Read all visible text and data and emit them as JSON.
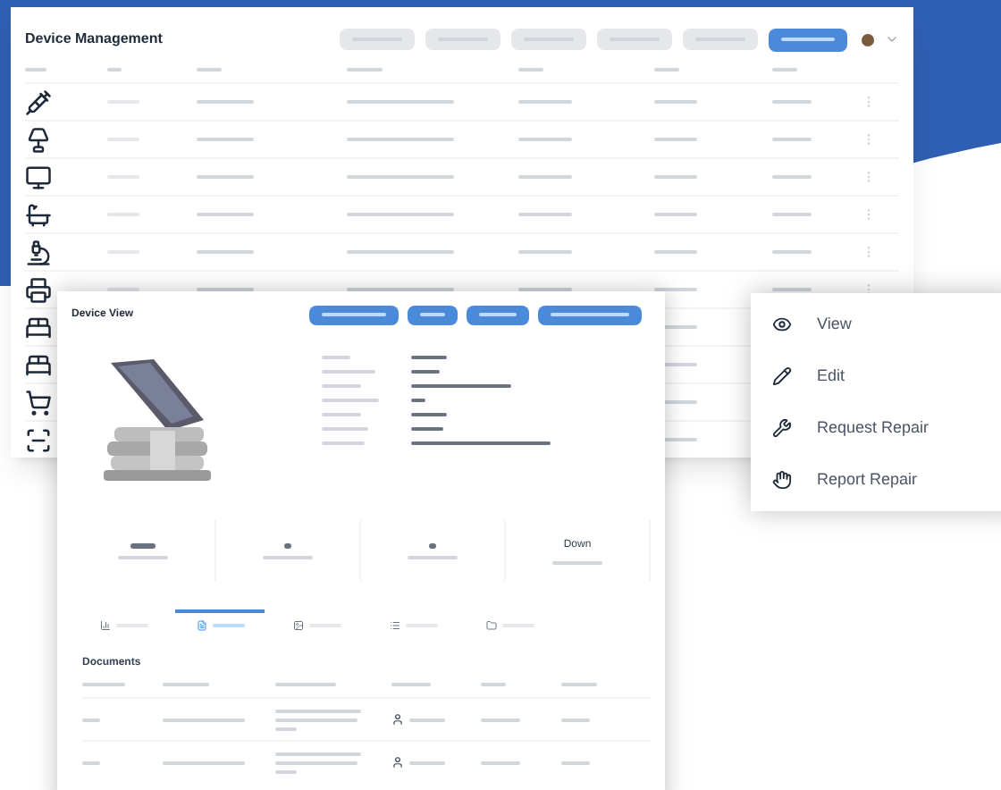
{
  "main_window": {
    "title": "Device Management",
    "rows": [
      {
        "kind": "probe"
      },
      {
        "kind": "lamp"
      },
      {
        "kind": "monitor"
      },
      {
        "kind": "basin"
      },
      {
        "kind": "stand"
      },
      {
        "kind": "printer"
      },
      {
        "kind": "bed"
      },
      {
        "kind": "bed"
      },
      {
        "kind": "cart"
      },
      {
        "kind": "scanner"
      }
    ]
  },
  "device_view": {
    "title": "Device View",
    "status": "Down",
    "tabs": [
      {
        "selected": false
      },
      {
        "selected": true
      },
      {
        "selected": false
      },
      {
        "selected": false
      },
      {
        "selected": false
      }
    ],
    "section_title": "Documents"
  },
  "context_menu": {
    "items": [
      {
        "kind": "view",
        "label": "View"
      },
      {
        "kind": "edit",
        "label": "Edit"
      },
      {
        "kind": "request",
        "label": "Request Repair"
      },
      {
        "kind": "report",
        "label": "Report Repair"
      }
    ]
  }
}
